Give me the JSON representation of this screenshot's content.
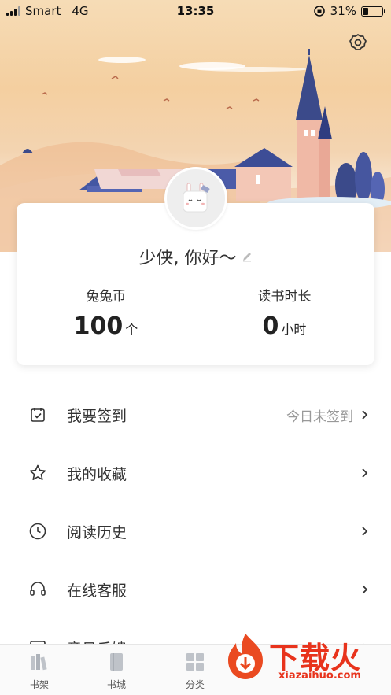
{
  "status_bar": {
    "carrier": "Smart",
    "network": "4G",
    "time": "13:35",
    "battery_percent": "31%",
    "battery_level": 0.31
  },
  "profile": {
    "greeting": "少侠, 你好～",
    "coins_label": "兔兔币",
    "coins_value": "100",
    "coins_unit": "个",
    "reading_label": "读书时长",
    "reading_value": "0",
    "reading_unit": "小时"
  },
  "menu": {
    "items": [
      {
        "label": "我要签到",
        "status": "今日未签到",
        "icon": "calendar-check-icon"
      },
      {
        "label": "我的收藏",
        "status": "",
        "icon": "star-icon"
      },
      {
        "label": "阅读历史",
        "status": "",
        "icon": "clock-icon"
      },
      {
        "label": "在线客服",
        "status": "",
        "icon": "headset-icon"
      },
      {
        "label": "意见反馈",
        "status": "",
        "icon": "feedback-icon"
      }
    ]
  },
  "tabs": [
    {
      "label": "书架",
      "icon": "bookshelf-icon"
    },
    {
      "label": "书城",
      "icon": "book-icon"
    },
    {
      "label": "分类",
      "icon": "grid-icon"
    }
  ],
  "watermark": {
    "text": "下载火",
    "url": "xiazaihuo.com"
  },
  "colors": {
    "accent": "#e8331c",
    "header_top": "#f6dcb6",
    "castle": "#3b4a8a"
  }
}
